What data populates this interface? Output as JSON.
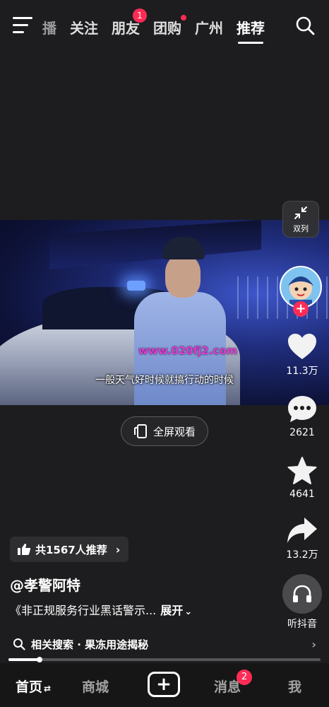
{
  "topbar": {
    "tabs": [
      {
        "label": "播",
        "faded": true
      },
      {
        "label": "关注"
      },
      {
        "label": "朋友",
        "badge": "1"
      },
      {
        "label": "团购",
        "dot": true
      },
      {
        "label": "广州"
      },
      {
        "label": "推荐",
        "active": true
      }
    ]
  },
  "video": {
    "watermark": "www.020fj2.com",
    "subtitle": "一般天气好时候就搞行动的时候"
  },
  "fullscreen": {
    "label": "全屏观看"
  },
  "rail": {
    "dual_label": "双列",
    "likes": "11.3万",
    "comments": "2621",
    "favorites": "4641",
    "shares": "13.2万",
    "listen_label": "听抖音"
  },
  "info": {
    "recommend": "共1567人推荐",
    "author": "@孝警阿特",
    "description": "《非正规服务行业黑话警示...",
    "expand": "展开"
  },
  "related": {
    "text": "相关搜索 · 果冻用途揭秘"
  },
  "progress": 0.1,
  "bottom_nav": {
    "home": "首页",
    "mall": "商城",
    "messages": "消息",
    "messages_badge": "2",
    "me": "我"
  },
  "colors": {
    "accent": "#fe2c55",
    "background": "#1d1d1f"
  }
}
